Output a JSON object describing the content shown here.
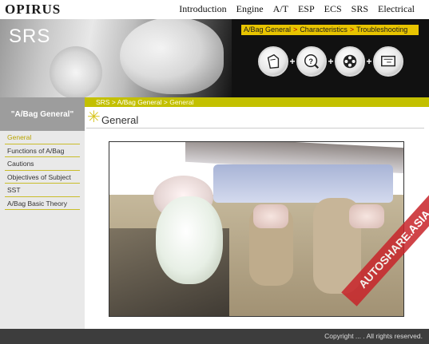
{
  "header": {
    "brand": "OPIRUS",
    "nav": [
      {
        "label": "Introduction"
      },
      {
        "label": "Engine"
      },
      {
        "label": "A/T"
      },
      {
        "label": "ESP"
      },
      {
        "label": "ECS"
      },
      {
        "label": "SRS"
      },
      {
        "label": "Electrical"
      }
    ],
    "active_nav": "SRS"
  },
  "banner": {
    "title": "SRS",
    "crumbs": [
      {
        "label": "A/Bag General"
      },
      {
        "label": "Characteristics"
      },
      {
        "label": "Troubleshooting"
      }
    ],
    "crumb_separator": ">",
    "tools": [
      {
        "icon": "document-icon"
      },
      {
        "icon": "question-icon"
      },
      {
        "icon": "film-reel-icon"
      },
      {
        "icon": "monitor-icon"
      }
    ],
    "tool_separator": "+"
  },
  "sidebar": {
    "title": "\"A/Bag General\"",
    "items": [
      {
        "label": "General",
        "active": true
      },
      {
        "label": "Functions of A/Bag"
      },
      {
        "label": "Cautions"
      },
      {
        "label": "Objectives of Subject"
      },
      {
        "label": "SST"
      },
      {
        "label": "A/Bag Basic Theory"
      }
    ]
  },
  "main": {
    "breadcrumb": {
      "part1": "SRS",
      "part2": "A/Bag General",
      "current": "General",
      "separator": ">"
    },
    "section_title": "General"
  },
  "watermark": {
    "text": "AUTOSHARE.ASIA"
  },
  "footer": {
    "copyright": "Copyright ... . All rights reserved."
  },
  "colors": {
    "accent_yellow": "#e8c400",
    "sidebar_head": "#9d9d9d",
    "crumb_bar": "#c3c000",
    "watermark_red": "#c8242a"
  }
}
